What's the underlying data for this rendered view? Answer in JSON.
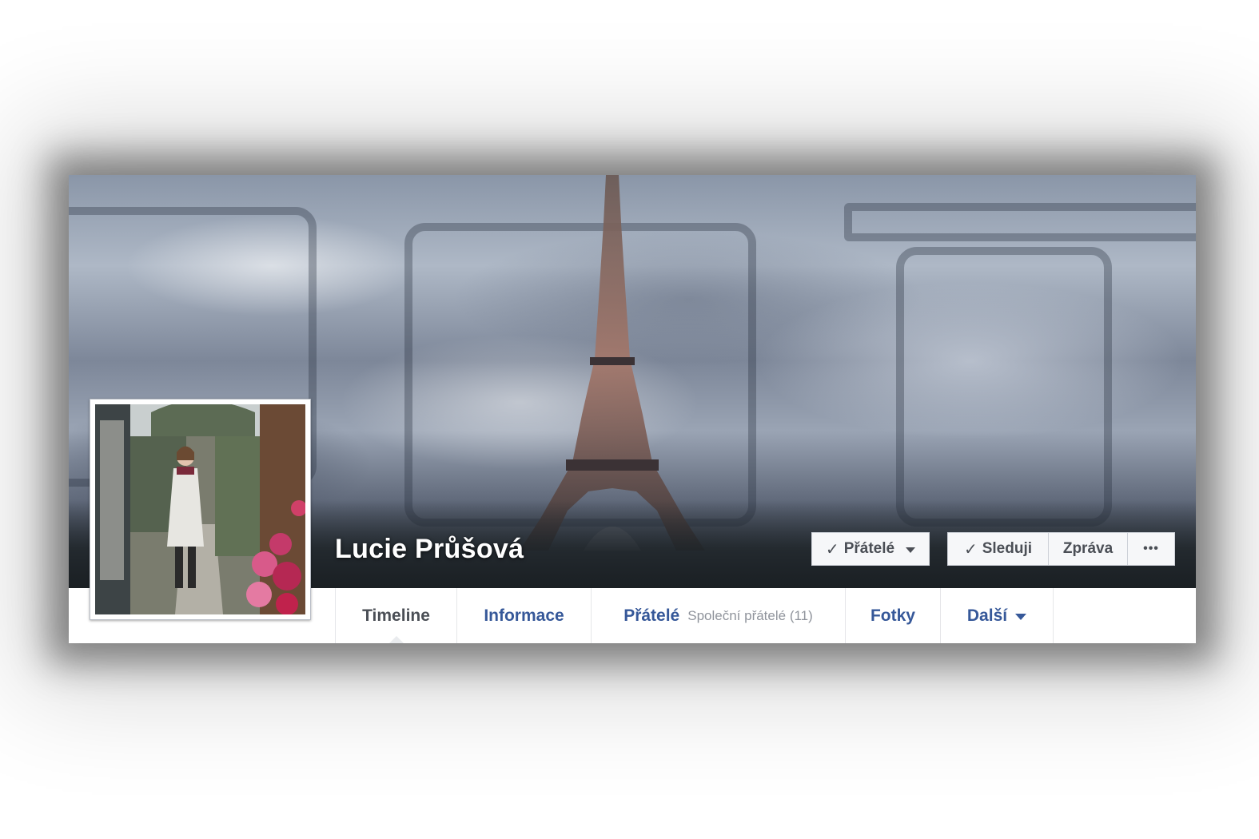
{
  "profile": {
    "name": "Lucie Průšová"
  },
  "actions": {
    "friends_label": "Přátelé",
    "following_label": "Sleduji",
    "message_label": "Zpráva",
    "more_label": "•••"
  },
  "tabs": [
    {
      "label": "Timeline",
      "active": true
    },
    {
      "label": "Informace"
    },
    {
      "label": "Přátelé",
      "sub": "Společní přátelé (11)"
    },
    {
      "label": "Fotky"
    },
    {
      "label": "Další"
    }
  ],
  "colors": {
    "link": "#365899",
    "text": "#4b4f56",
    "muted": "#90949c"
  },
  "icons": {
    "check": "check-icon",
    "dropdown": "caret-down-icon",
    "more": "ellipsis-icon"
  }
}
